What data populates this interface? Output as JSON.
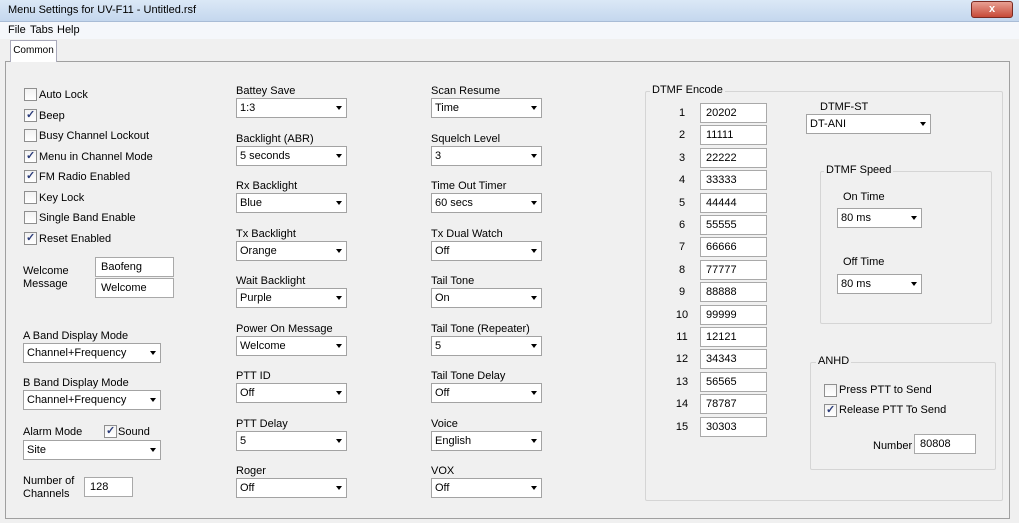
{
  "window": {
    "title": "Menu Settings for UV-F11 - Untitled.rsf",
    "close_label": "x"
  },
  "menu": {
    "file": "File",
    "tabs": "Tabs",
    "help": "Help"
  },
  "tab": {
    "label": "Common"
  },
  "checkboxes": [
    {
      "label": "Auto Lock",
      "checked": false
    },
    {
      "label": "Beep",
      "checked": true
    },
    {
      "label": "Busy Channel Lockout",
      "checked": false
    },
    {
      "label": "Menu in Channel Mode",
      "checked": true
    },
    {
      "label": "FM Radio Enabled",
      "checked": true
    },
    {
      "label": "Key Lock",
      "checked": false
    },
    {
      "label": "Single Band Enable",
      "checked": false
    },
    {
      "label": "Reset Enabled",
      "checked": true
    }
  ],
  "welcome": {
    "label_line1": "Welcome",
    "label_line2": "Message",
    "line1": "Baofeng",
    "line2": "Welcome"
  },
  "a_band": {
    "label": "A Band Display Mode",
    "value": "Channel+Frequency"
  },
  "b_band": {
    "label": "B Band Display Mode",
    "value": "Channel+Frequency"
  },
  "alarm": {
    "label": "Alarm Mode",
    "sound_label": "Sound",
    "sound_checked": true,
    "value": "Site"
  },
  "channels": {
    "label_line1": "Number of",
    "label_line2": "Channels",
    "value": "128"
  },
  "col2": [
    {
      "label": "Battey Save",
      "value": "1:3"
    },
    {
      "label": "Backlight (ABR)",
      "value": "5 seconds"
    },
    {
      "label": "Rx Backlight",
      "value": "Blue"
    },
    {
      "label": "Tx Backlight",
      "value": "Orange"
    },
    {
      "label": "Wait Backlight",
      "value": "Purple"
    },
    {
      "label": "Power On Message",
      "value": "Welcome"
    },
    {
      "label": "PTT ID",
      "value": "Off"
    },
    {
      "label": "PTT Delay",
      "value": "5"
    },
    {
      "label": "Roger",
      "value": "Off"
    }
  ],
  "col3": [
    {
      "label": "Scan Resume",
      "value": "Time"
    },
    {
      "label": "Squelch Level",
      "value": "3"
    },
    {
      "label": "Time Out Timer",
      "value": "60 secs"
    },
    {
      "label": "Tx Dual Watch",
      "value": "Off"
    },
    {
      "label": "Tail Tone",
      "value": "On"
    },
    {
      "label": "Tail Tone (Repeater)",
      "value": "5"
    },
    {
      "label": "Tail Tone Delay",
      "value": "Off"
    },
    {
      "label": "Voice",
      "value": "English"
    },
    {
      "label": "VOX",
      "value": "Off"
    }
  ],
  "dtmf": {
    "title": "DTMF Encode",
    "codes": [
      {
        "n": "1",
        "v": "20202"
      },
      {
        "n": "2",
        "v": "11111"
      },
      {
        "n": "3",
        "v": "22222"
      },
      {
        "n": "4",
        "v": "33333"
      },
      {
        "n": "5",
        "v": "44444"
      },
      {
        "n": "6",
        "v": "55555"
      },
      {
        "n": "7",
        "v": "66666"
      },
      {
        "n": "8",
        "v": "77777"
      },
      {
        "n": "9",
        "v": "88888"
      },
      {
        "n": "10",
        "v": "99999"
      },
      {
        "n": "11",
        "v": "12121"
      },
      {
        "n": "12",
        "v": "34343"
      },
      {
        "n": "13",
        "v": "56565"
      },
      {
        "n": "14",
        "v": "78787"
      },
      {
        "n": "15",
        "v": "30303"
      }
    ],
    "st_label": "DTMF-ST",
    "st_value": "DT-ANI",
    "speed_title": "DTMF Speed",
    "on_time_label": "On Time",
    "on_time_value": "80 ms",
    "off_time_label": "Off Time",
    "off_time_value": "80 ms"
  },
  "anhd": {
    "title": "ANHD",
    "press_label": "Press PTT to Send",
    "press_checked": false,
    "release_label": "Release PTT To Send",
    "release_checked": true,
    "number_label": "Number",
    "number_value": "80808"
  },
  "colors": {
    "titlebar": "#c4d7ee",
    "close": "#c74a38",
    "panel": "#f0f0f0"
  }
}
